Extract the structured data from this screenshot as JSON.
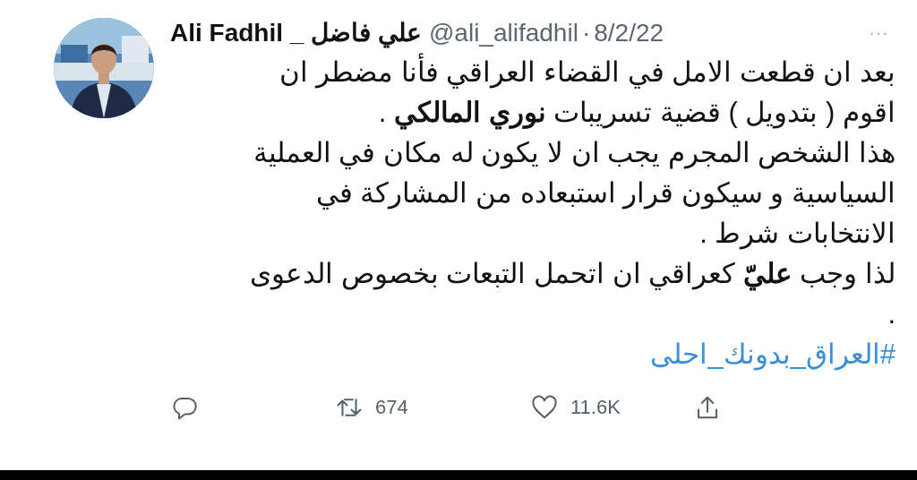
{
  "tweet": {
    "author_name": "Ali Fadhil _ علي فاضل",
    "handle": "@ali_alifadhil",
    "separator": "·",
    "date": "8/2/22",
    "more": "···",
    "lines": [
      "بعد ان قطعت الامل في القضاء العراقي فأنا مضطر ان",
      "اقوم ( بتدويل ) قضية تسريبات **نوري المالكي** .",
      "هذا الشخص المجرم يجب ان لا يكون له مكان في العملية",
      "السياسية و سيكون قرار استبعاده من المشاركة في",
      "الانتخابات شرط .",
      "لذا وجب **عليّ** كعراقي ان اتحمل التبعات بخصوص الدعوى",
      "."
    ],
    "hashtag": "#العراق_بدونك_احلى",
    "retweet_count": "674",
    "like_count": "11.6K"
  }
}
